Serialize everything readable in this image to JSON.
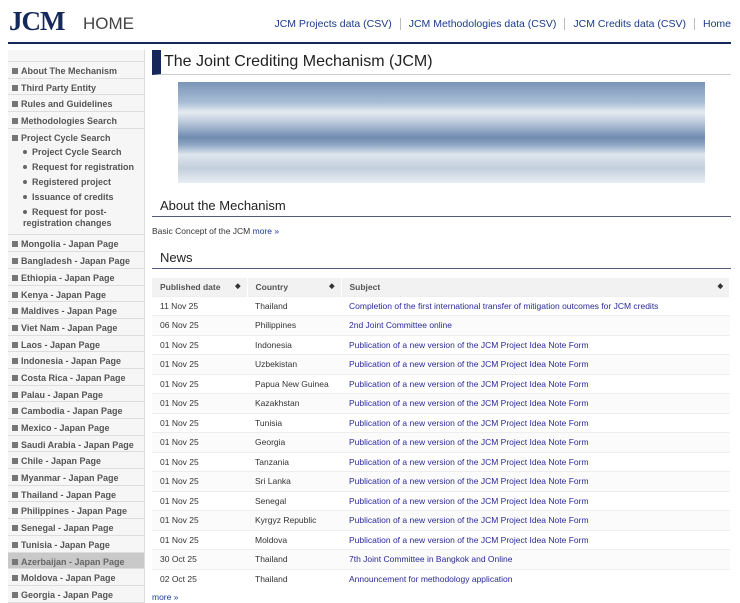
{
  "header": {
    "logo": "JCM",
    "home": "HOME",
    "nav": [
      "JCM Projects data (CSV)",
      "JCM Methodologies data (CSV)",
      "JCM Credits data (CSV)",
      "Home"
    ]
  },
  "sidebar": {
    "top": [
      "About The Mechanism",
      "Third Party Entity",
      "Rules and Guidelines",
      "Methodologies Search"
    ],
    "project_cycle": {
      "label": "Project Cycle Search",
      "subs": [
        "Project Cycle Search",
        "Request for registration",
        "Registered project",
        "Issuance of credits",
        "Request for post-registration changes"
      ]
    },
    "countries": [
      "Mongolia - Japan Page",
      "Bangladesh - Japan Page",
      "Ethiopia - Japan Page",
      "Kenya - Japan Page",
      "Maldives - Japan Page",
      "Viet Nam - Japan Page",
      "Laos - Japan Page",
      "Indonesia - Japan Page",
      "Costa Rica - Japan Page",
      "Palau - Japan Page",
      "Cambodia - Japan Page",
      "Mexico - Japan Page",
      "Saudi Arabia - Japan Page",
      "Chile - Japan Page",
      "Myanmar - Japan Page",
      "Thailand - Japan Page",
      "Philippines - Japan Page",
      "Senegal - Japan Page",
      "Tunisia - Japan Page",
      "Azerbaijan - Japan Page",
      "Moldova - Japan Page",
      "Georgia - Japan Page"
    ],
    "active": "Azerbaijan - Japan Page"
  },
  "main": {
    "title": "The Joint Crediting Mechanism (JCM)",
    "about_heading": "About the Mechanism",
    "about_text": "Basic Concept of the JCM",
    "about_more": "more »",
    "news_heading": "News",
    "more": "more »",
    "columns": [
      "Published date",
      "Country",
      "Subject"
    ],
    "news": [
      [
        "11 Nov 25",
        "Thailand",
        "Completion of the first international transfer of mitigation outcomes for JCM credits"
      ],
      [
        "06 Nov 25",
        "Philippines",
        "2nd Joint Committee online"
      ],
      [
        "01 Nov 25",
        "Indonesia",
        "Publication of a new version of the JCM Project Idea Note Form"
      ],
      [
        "01 Nov 25",
        "Uzbekistan",
        "Publication of a new version of the JCM Project Idea Note Form"
      ],
      [
        "01 Nov 25",
        "Papua New Guinea",
        "Publication of a new version of the JCM Project Idea Note Form"
      ],
      [
        "01 Nov 25",
        "Kazakhstan",
        "Publication of a new version of the JCM Project Idea Note Form"
      ],
      [
        "01 Nov 25",
        "Tunisia",
        "Publication of a new version of the JCM Project Idea Note Form"
      ],
      [
        "01 Nov 25",
        "Georgia",
        "Publication of a new version of the JCM Project Idea Note Form"
      ],
      [
        "01 Nov 25",
        "Tanzania",
        "Publication of a new version of the JCM Project Idea Note Form"
      ],
      [
        "01 Nov 25",
        "Sri Lanka",
        "Publication of a new version of the JCM Project Idea Note Form"
      ],
      [
        "01 Nov 25",
        "Senegal",
        "Publication of a new version of the JCM Project Idea Note Form"
      ],
      [
        "01 Nov 25",
        "Kyrgyz Republic",
        "Publication of a new version of the JCM Project Idea Note Form"
      ],
      [
        "01 Nov 25",
        "Moldova",
        "Publication of a new version of the JCM Project Idea Note Form"
      ],
      [
        "30 Oct 25",
        "Thailand",
        "7th Joint Committee in Bangkok and Online"
      ],
      [
        "02 Oct 25",
        "Thailand",
        "Announcement for methodology application"
      ]
    ]
  }
}
